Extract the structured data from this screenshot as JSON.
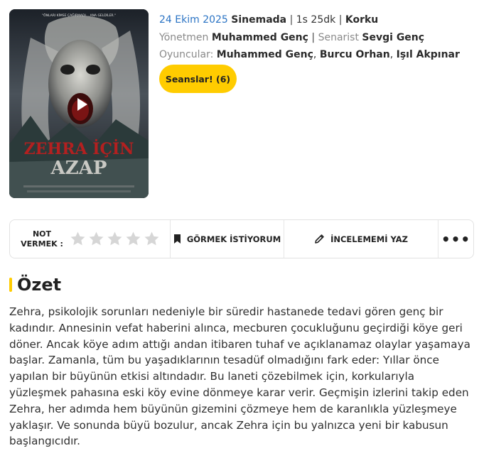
{
  "poster": {
    "tagline": "\"ÖNLARI KİMSE ÇAĞIRMADI... ANA GELDİLER.\"",
    "title_line1": "ZEHRA İÇİN",
    "title_line2": "AZAP",
    "play_icon": "play-icon"
  },
  "meta": {
    "release_date": "24 Ekim 2025",
    "release_status": "Sinemada",
    "duration": "1s 25dk",
    "genre": "Korku",
    "director_label": "Yönetmen",
    "director": "Muhammed Genç",
    "writer_label": "Senarist",
    "writer": "Sevgi Genç",
    "cast_label": "Oyuncular:",
    "cast": [
      "Muhammed Genç",
      "Burcu Orhan",
      "Işıl Akpınar"
    ]
  },
  "sessions_button": "Seanslar! (6)",
  "actions": {
    "rate_label_line1": "NOT",
    "rate_label_line2": "VERMEK :",
    "stars_total": 5,
    "stars_filled": 0,
    "want_label": "GÖRMEK İSTİYORUM",
    "review_label": "İNCELEMEMİ YAZ",
    "more_label": "•••",
    "icons": [
      "bookmark-icon",
      "pencil-icon",
      "more-icon",
      "star-icon"
    ]
  },
  "colors": {
    "accent": "#ffcc00",
    "link_blue": "#2a73c4",
    "muted": "#8a8a8a",
    "star_empty": "#d6d6d6"
  },
  "summary": {
    "title": "Özet",
    "text": "Zehra, psikolojik sorunları nedeniyle bir süredir hastanede tedavi gören genç bir kadındır. Annesinin vefat haberini alınca, mecburen çocukluğunu geçirdiği köye geri döner. Ancak köye adım attığı andan itibaren tuhaf ve açıklanamaz olaylar yaşamaya başlar. Zamanla, tüm bu yaşadıklarının tesadüf olmadığını fark eder: Yıllar önce yapılan bir büyünün etkisi altındadır. Bu laneti çözebilmek için, korkularıyla yüzleşmek pahasına eski köy evine dönmeye karar verir. Geçmişin izlerini takip eden Zehra, her adımda hem büyünün gizemini çözmeye hem de karanlıkla yüzleşmeye yaklaşır. Ve sonunda büyü bozulur, ancak Zehra için bu yalnızca yeni bir kabusun başlangıcıdır."
  }
}
